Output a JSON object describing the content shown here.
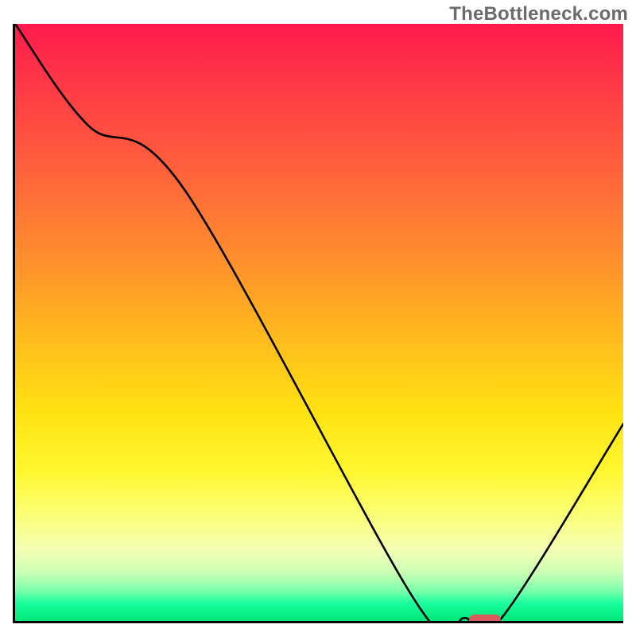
{
  "watermark": "TheBottleneck.com",
  "chart_data": {
    "type": "line",
    "title": "",
    "xlabel": "",
    "ylabel": "",
    "x_range": [
      0,
      100
    ],
    "y_range": [
      0,
      100
    ],
    "grid": false,
    "legend": false,
    "series": [
      {
        "name": "curve",
        "x": [
          0,
          12,
          28,
          66,
          74,
          80,
          100
        ],
        "y": [
          100,
          83,
          72,
          3,
          0.5,
          0.5,
          33
        ]
      }
    ],
    "marker": {
      "x": 77,
      "y": 0.5,
      "color": "#d85a5a"
    },
    "background_gradient": {
      "top": "#ff1a4d",
      "upper_mid": "#ff8a2e",
      "mid": "#ffe212",
      "lower_mid": "#fbff74",
      "bottom": "#00e676"
    }
  }
}
